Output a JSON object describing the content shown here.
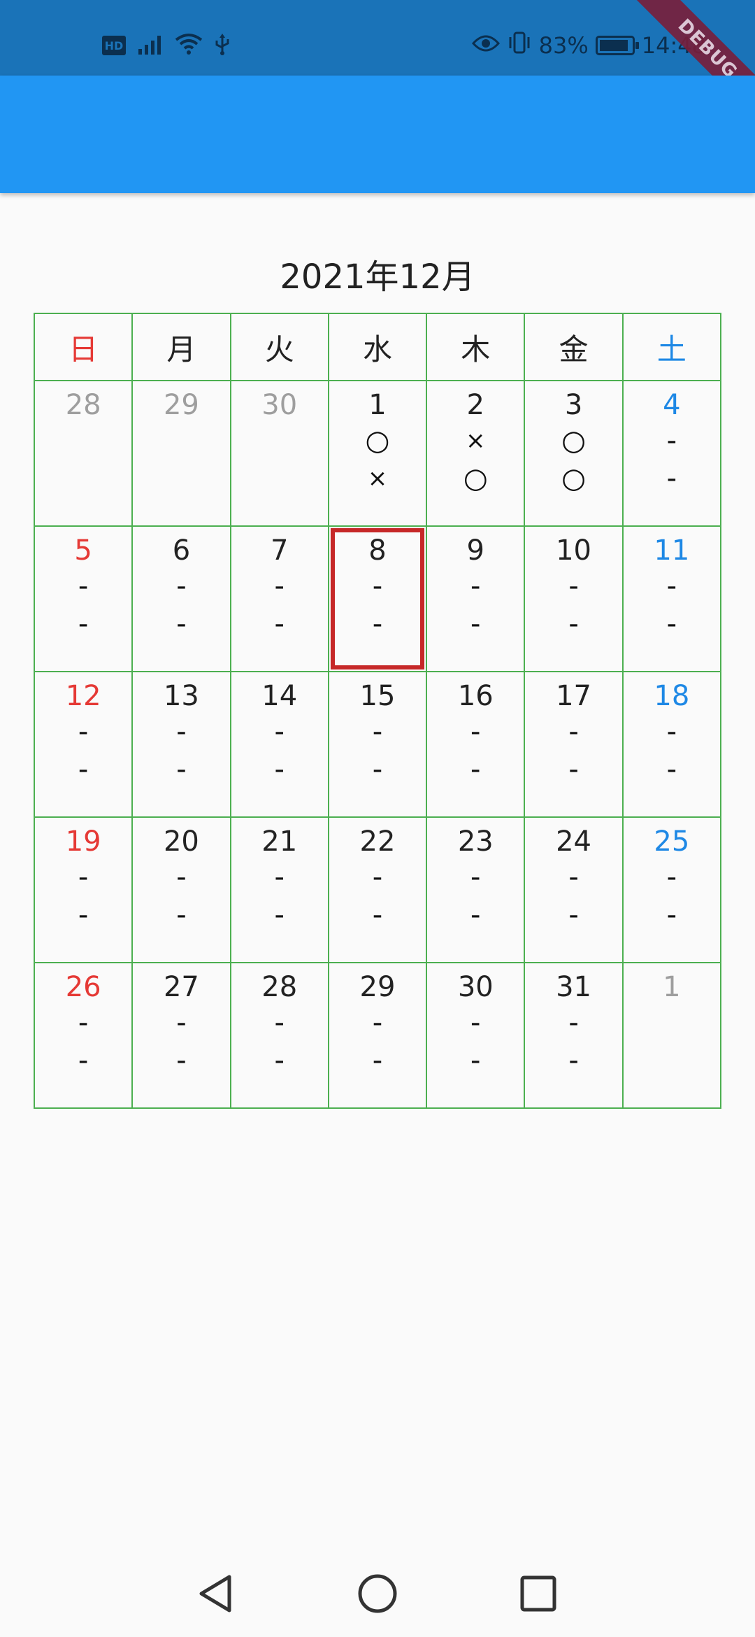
{
  "status_bar": {
    "hd_label": "HD",
    "battery_percent": "83%",
    "time": "14:48",
    "icons": [
      "signal-icon",
      "wifi-icon",
      "usb-icon",
      "eye-icon",
      "vibrate-icon",
      "battery-icon"
    ]
  },
  "debug_banner": "DEBUG",
  "calendar": {
    "title": "2021年12月",
    "weekdays": [
      "日",
      "月",
      "火",
      "水",
      "木",
      "金",
      "土"
    ],
    "weeks": [
      [
        {
          "day": "28",
          "marks": [],
          "other": true
        },
        {
          "day": "29",
          "marks": [],
          "other": true
        },
        {
          "day": "30",
          "marks": [],
          "other": true
        },
        {
          "day": "1",
          "marks": [
            "○",
            "×"
          ]
        },
        {
          "day": "2",
          "marks": [
            "×",
            "○"
          ]
        },
        {
          "day": "3",
          "marks": [
            "○",
            "○"
          ]
        },
        {
          "day": "4",
          "marks": [
            "-",
            "-"
          ]
        }
      ],
      [
        {
          "day": "5",
          "marks": [
            "-",
            "-"
          ]
        },
        {
          "day": "6",
          "marks": [
            "-",
            "-"
          ]
        },
        {
          "day": "7",
          "marks": [
            "-",
            "-"
          ]
        },
        {
          "day": "8",
          "marks": [
            "-",
            "-"
          ],
          "selected": true
        },
        {
          "day": "9",
          "marks": [
            "-",
            "-"
          ]
        },
        {
          "day": "10",
          "marks": [
            "-",
            "-"
          ]
        },
        {
          "day": "11",
          "marks": [
            "-",
            "-"
          ]
        }
      ],
      [
        {
          "day": "12",
          "marks": [
            "-",
            "-"
          ]
        },
        {
          "day": "13",
          "marks": [
            "-",
            "-"
          ]
        },
        {
          "day": "14",
          "marks": [
            "-",
            "-"
          ]
        },
        {
          "day": "15",
          "marks": [
            "-",
            "-"
          ]
        },
        {
          "day": "16",
          "marks": [
            "-",
            "-"
          ]
        },
        {
          "day": "17",
          "marks": [
            "-",
            "-"
          ]
        },
        {
          "day": "18",
          "marks": [
            "-",
            "-"
          ]
        }
      ],
      [
        {
          "day": "19",
          "marks": [
            "-",
            "-"
          ]
        },
        {
          "day": "20",
          "marks": [
            "-",
            "-"
          ]
        },
        {
          "day": "21",
          "marks": [
            "-",
            "-"
          ]
        },
        {
          "day": "22",
          "marks": [
            "-",
            "-"
          ]
        },
        {
          "day": "23",
          "marks": [
            "-",
            "-"
          ]
        },
        {
          "day": "24",
          "marks": [
            "-",
            "-"
          ]
        },
        {
          "day": "25",
          "marks": [
            "-",
            "-"
          ]
        }
      ],
      [
        {
          "day": "26",
          "marks": [
            "-",
            "-"
          ]
        },
        {
          "day": "27",
          "marks": [
            "-",
            "-"
          ]
        },
        {
          "day": "28",
          "marks": [
            "-",
            "-"
          ]
        },
        {
          "day": "29",
          "marks": [
            "-",
            "-"
          ]
        },
        {
          "day": "30",
          "marks": [
            "-",
            "-"
          ]
        },
        {
          "day": "31",
          "marks": [
            "-",
            "-"
          ]
        },
        {
          "day": "1",
          "marks": [],
          "other": true
        }
      ]
    ]
  },
  "colors": {
    "status_bar": "#1a73b8",
    "app_bar": "#2196f3",
    "grid": "#4caf50",
    "sunday": "#e53935",
    "saturday": "#1e88e5",
    "other_month": "#9e9e9e",
    "selected_border": "#c62828"
  },
  "nav_bar": {
    "icons": [
      "back-icon",
      "home-icon",
      "recents-icon"
    ]
  }
}
